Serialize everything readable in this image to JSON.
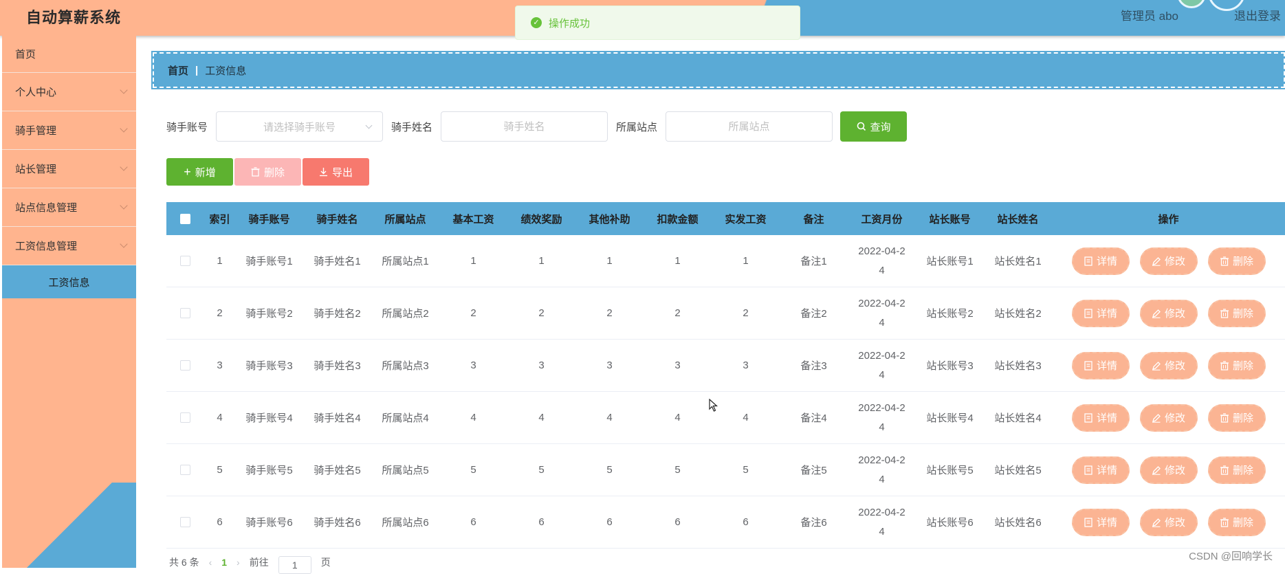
{
  "app": {
    "title": "自动算薪系统",
    "user": "管理员 abo",
    "logout": "退出登录"
  },
  "toast": {
    "message": "操作成功"
  },
  "sidebar": {
    "items": [
      {
        "label": "首页",
        "has_arrow": false
      },
      {
        "label": "个人中心",
        "has_arrow": true
      },
      {
        "label": "骑手管理",
        "has_arrow": true
      },
      {
        "label": "站长管理",
        "has_arrow": true
      },
      {
        "label": "站点信息管理",
        "has_arrow": true
      },
      {
        "label": "工资信息管理",
        "has_arrow": true
      }
    ],
    "sub_active": "工资信息"
  },
  "breadcrumb": {
    "home": "首页",
    "separator": "|",
    "current": "工资信息"
  },
  "search": {
    "rider_account_label": "骑手账号",
    "rider_account_placeholder": "请选择骑手账号",
    "rider_name_label": "骑手姓名",
    "rider_name_placeholder": "骑手姓名",
    "station_label": "所属站点",
    "station_placeholder": "所属站点",
    "query_label": "查询"
  },
  "actions": {
    "add_label": "新增",
    "delete_label": "删除",
    "export_label": "导出"
  },
  "table": {
    "headers": [
      "索引",
      "骑手账号",
      "骑手姓名",
      "所属站点",
      "基本工资",
      "绩效奖励",
      "其他补助",
      "扣款金额",
      "实发工资",
      "备注",
      "工资月份",
      "站长账号",
      "站长姓名",
      "操作"
    ],
    "op_labels": {
      "detail": "详情",
      "edit": "修改",
      "delete": "删除"
    },
    "rows": [
      [
        "1",
        "骑手账号1",
        "骑手姓名1",
        "所属站点1",
        "1",
        "1",
        "1",
        "1",
        "1",
        "备注1",
        "2022-04-24",
        "站长账号1",
        "站长姓名1"
      ],
      [
        "2",
        "骑手账号2",
        "骑手姓名2",
        "所属站点2",
        "2",
        "2",
        "2",
        "2",
        "2",
        "备注2",
        "2022-04-24",
        "站长账号2",
        "站长姓名2"
      ],
      [
        "3",
        "骑手账号3",
        "骑手姓名3",
        "所属站点3",
        "3",
        "3",
        "3",
        "3",
        "3",
        "备注3",
        "2022-04-24",
        "站长账号3",
        "站长姓名3"
      ],
      [
        "4",
        "骑手账号4",
        "骑手姓名4",
        "所属站点4",
        "4",
        "4",
        "4",
        "4",
        "4",
        "备注4",
        "2022-04-24",
        "站长账号4",
        "站长姓名4"
      ],
      [
        "5",
        "骑手账号5",
        "骑手姓名5",
        "所属站点5",
        "5",
        "5",
        "5",
        "5",
        "5",
        "备注5",
        "2022-04-24",
        "站长账号5",
        "站长姓名5"
      ],
      [
        "6",
        "骑手账号6",
        "骑手姓名6",
        "所属站点6",
        "6",
        "6",
        "6",
        "6",
        "6",
        "备注6",
        "2022-04-24",
        "站长账号6",
        "站长姓名6"
      ]
    ]
  },
  "pagination": {
    "total": "共 6 条",
    "current_page": "1",
    "goto_label": "前往",
    "goto_value": "1",
    "page_unit": "页"
  },
  "watermark": "CSDN @回响学长",
  "colors": {
    "peach": "#ffb48e",
    "blue": "#5aaad6",
    "green": "#5eb230",
    "success": "#67c23a",
    "danger_light": "#fcb6b6",
    "danger": "#f7796e"
  }
}
